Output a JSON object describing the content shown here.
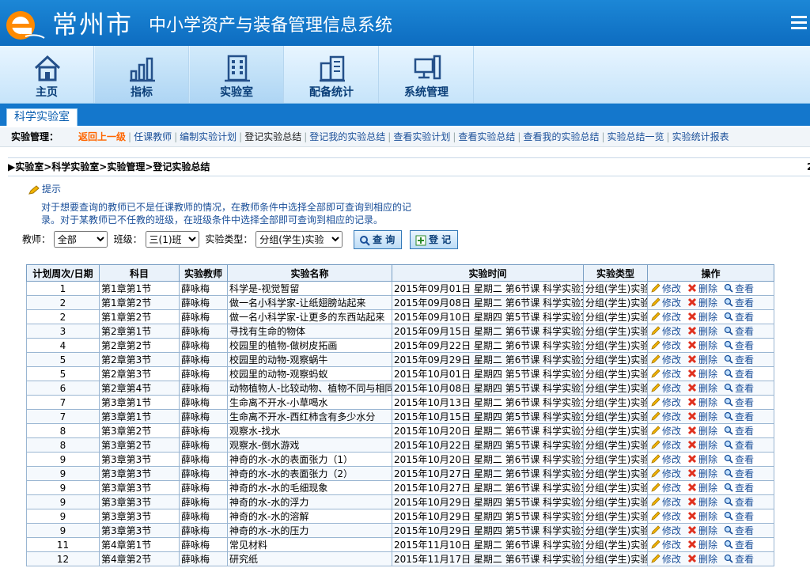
{
  "app": {
    "city": "常州市",
    "system_name": "中小学资产与装备管理信息系统"
  },
  "nav": [
    {
      "label": "主页",
      "icon": "home-icon"
    },
    {
      "label": "指标",
      "icon": "bar-chart-icon"
    },
    {
      "label": "实验室",
      "icon": "building-icon"
    },
    {
      "label": "配备统计",
      "icon": "stats-building-icon"
    },
    {
      "label": "系统管理",
      "icon": "computer-icon"
    }
  ],
  "subtab": "科学实验室",
  "actions": {
    "label": "实验管理：",
    "items": [
      "返回上一级",
      "任课教师",
      "编制实验计划",
      "登记实验总结",
      "登记我的实验总结",
      "查看实验计划",
      "查看实验总结",
      "查看我的实验总结",
      "实验总结一览",
      "实验统计报表"
    ]
  },
  "breadcrumb": "实验室>科学实验室>实验管理>登记实验总结",
  "breadcrumb_extra": "2",
  "tip": {
    "title": "提示",
    "text": "对于想要查询的教师已不是任课教师的情况，在教师条件中选择全部即可查询到相应的记录。对于某教师已不任教的班级，在班级条件中选择全部即可查询到相应的记录。"
  },
  "filters": {
    "teacher_label": "教师：",
    "teacher_value": "全部",
    "class_label": "班级：",
    "class_value": "三(1)班",
    "type_label": "实验类型：",
    "type_value": "分组(学生)实验",
    "query_label": "查 询",
    "register_label": "登 记"
  },
  "table": {
    "headers": [
      "计划周次/日期",
      "科目",
      "实验教师",
      "实验名称",
      "实验时间",
      "实验类型",
      "操作"
    ],
    "op_labels": {
      "edit": "修改",
      "delete": "删除",
      "view": "查看"
    },
    "rows": [
      [
        "1",
        "第1章第1节",
        "薛咏梅",
        "科学是-视觉暂留",
        "2015年09月01日 星期二 第6节课 科学实验室",
        "分组(学生)实验"
      ],
      [
        "2",
        "第1章第2节",
        "薛咏梅",
        "做一名小科学家-让纸翅膀站起来",
        "2015年09月08日 星期二 第6节课 科学实验室",
        "分组(学生)实验"
      ],
      [
        "2",
        "第1章第2节",
        "薛咏梅",
        "做一名小科学家-让更多的东西站起来",
        "2015年09月10日 星期四 第5节课 科学实验室",
        "分组(学生)实验"
      ],
      [
        "3",
        "第2章第1节",
        "薛咏梅",
        "寻找有生命的物体",
        "2015年09月15日 星期二 第6节课 科学实验室",
        "分组(学生)实验"
      ],
      [
        "4",
        "第2章第2节",
        "薛咏梅",
        "校园里的植物-做树皮拓画",
        "2015年09月22日 星期二 第6节课 科学实验室",
        "分组(学生)实验"
      ],
      [
        "5",
        "第2章第3节",
        "薛咏梅",
        "校园里的动物-观察蜗牛",
        "2015年09月29日 星期二 第6节课 科学实验室",
        "分组(学生)实验"
      ],
      [
        "5",
        "第2章第3节",
        "薛咏梅",
        "校园里的动物-观察蚂蚁",
        "2015年10月01日 星期四 第5节课 科学实验室",
        "分组(学生)实验"
      ],
      [
        "6",
        "第2章第4节",
        "薛咏梅",
        "动物植物人-比较动物、植物不同与相同",
        "2015年10月08日 星期四 第5节课 科学实验室",
        "分组(学生)实验"
      ],
      [
        "7",
        "第3章第1节",
        "薛咏梅",
        "生命离不开水-小草喝水",
        "2015年10月13日 星期二 第6节课 科学实验室",
        "分组(学生)实验"
      ],
      [
        "7",
        "第3章第1节",
        "薛咏梅",
        "生命离不开水-西红柿含有多少水分",
        "2015年10月15日 星期四 第5节课 科学实验室",
        "分组(学生)实验"
      ],
      [
        "8",
        "第3章第2节",
        "薛咏梅",
        "观察水-找水",
        "2015年10月20日 星期二 第6节课 科学实验室",
        "分组(学生)实验"
      ],
      [
        "8",
        "第3章第2节",
        "薛咏梅",
        "观察水-倒水游戏",
        "2015年10月22日 星期四 第5节课 科学实验室",
        "分组(学生)实验"
      ],
      [
        "9",
        "第3章第3节",
        "薛咏梅",
        "神奇的水-水的表面张力（1）",
        "2015年10月20日 星期二 第6节课 科学实验室",
        "分组(学生)实验"
      ],
      [
        "9",
        "第3章第3节",
        "薛咏梅",
        "神奇的水-水的表面张力（2）",
        "2015年10月27日 星期二 第6节课 科学实验室",
        "分组(学生)实验"
      ],
      [
        "9",
        "第3章第3节",
        "薛咏梅",
        "神奇的水-水的毛细现象",
        "2015年10月27日 星期二 第6节课 科学实验室",
        "分组(学生)实验"
      ],
      [
        "9",
        "第3章第3节",
        "薛咏梅",
        "神奇的水-水的浮力",
        "2015年10月29日 星期四 第5节课 科学实验室",
        "分组(学生)实验"
      ],
      [
        "9",
        "第3章第3节",
        "薛咏梅",
        "神奇的水-水的溶解",
        "2015年10月29日 星期四 第5节课 科学实验室",
        "分组(学生)实验"
      ],
      [
        "9",
        "第3章第3节",
        "薛咏梅",
        "神奇的水-水的压力",
        "2015年10月29日 星期四 第5节课 科学实验室",
        "分组(学生)实验"
      ],
      [
        "11",
        "第4章第1节",
        "薛咏梅",
        "常见材料",
        "2015年11月10日 星期二 第6节课 科学实验室",
        "分组(学生)实验"
      ],
      [
        "12",
        "第4章第2节",
        "薛咏梅",
        "研究纸",
        "2015年11月17日 星期二 第6节课 科学实验室",
        "分组(学生)实验"
      ]
    ]
  },
  "colors": {
    "header_blue": "#0d6cc0",
    "link_blue": "#1a4f99",
    "back_orange": "#ff6600"
  }
}
